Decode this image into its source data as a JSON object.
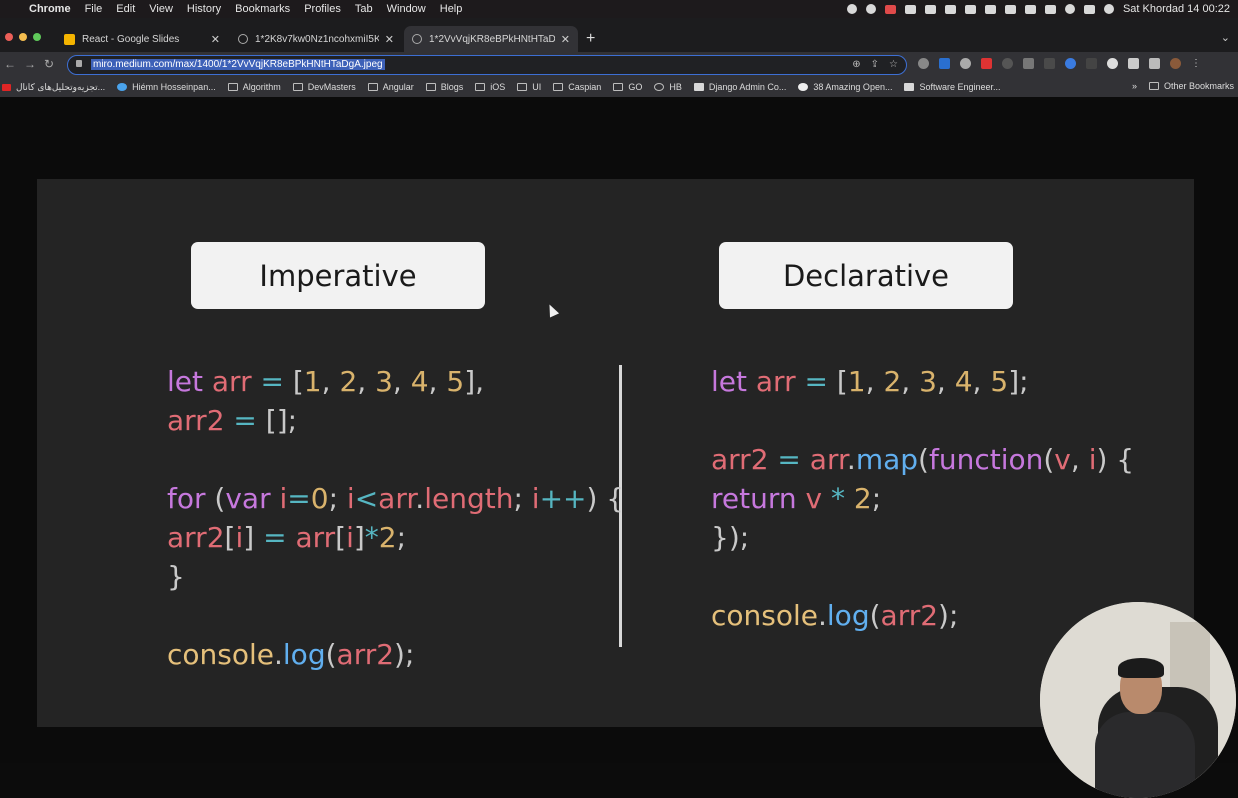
{
  "menubar": {
    "apple_glyph": "",
    "items": [
      "Chrome",
      "File",
      "Edit",
      "View",
      "History",
      "Bookmarks",
      "Profiles",
      "Tab",
      "Window",
      "Help"
    ],
    "clock": "Sat Khordad 14  00:22"
  },
  "tabs": [
    {
      "title": "React - Google Slides",
      "active": false
    },
    {
      "title": "1*2K8v7kw0Nz1ncohxmiI5KA.j",
      "active": false
    },
    {
      "title": "1*2VvVqjKR8eBPkHNtHTaDgA",
      "active": true
    }
  ],
  "toolbar": {
    "url": "miro.medium.com/max/1400/1*2VvVqjKR8eBPkHNtHTaDgA.jpeg"
  },
  "bookmarks": {
    "items": [
      {
        "label": "تجزیه‌وتحلیل‌های کانال...",
        "icon": "youtube-icon"
      },
      {
        "label": "Hiémn Hosseinpan...",
        "icon": "twitter-icon"
      },
      {
        "label": "Algorithm",
        "icon": "folder-icon"
      },
      {
        "label": "DevMasters",
        "icon": "folder-icon"
      },
      {
        "label": "Angular",
        "icon": "folder-icon"
      },
      {
        "label": "Blogs",
        "icon": "folder-icon"
      },
      {
        "label": "iOS",
        "icon": "folder-icon"
      },
      {
        "label": "UI",
        "icon": "folder-icon"
      },
      {
        "label": "Caspian",
        "icon": "folder-icon"
      },
      {
        "label": "GO",
        "icon": "folder-icon"
      },
      {
        "label": "HB",
        "icon": "globe-icon"
      },
      {
        "label": "Django Admin Co...",
        "icon": "page-icon"
      },
      {
        "label": "38 Amazing Open...",
        "icon": "github-icon"
      },
      {
        "label": "Software Engineer...",
        "icon": "page-icon"
      }
    ],
    "overflow": "»",
    "other": "Other Bookmarks"
  },
  "slide": {
    "left_title": "Imperative",
    "right_title": "Declarative",
    "left_code": [
      [
        {
          "t": "let ",
          "c": "kw"
        },
        {
          "t": "arr ",
          "c": "var"
        },
        {
          "t": "= ",
          "c": "op"
        },
        {
          "t": "[",
          "c": "pun"
        },
        {
          "t": "1",
          "c": "num"
        },
        {
          "t": ", ",
          "c": "pun"
        },
        {
          "t": "2",
          "c": "num"
        },
        {
          "t": ", ",
          "c": "pun"
        },
        {
          "t": "3",
          "c": "num"
        },
        {
          "t": ", ",
          "c": "pun"
        },
        {
          "t": "4",
          "c": "num"
        },
        {
          "t": ", ",
          "c": "pun"
        },
        {
          "t": "5",
          "c": "num"
        },
        {
          "t": "],",
          "c": "pun"
        }
      ],
      [
        {
          "t": "arr2 ",
          "c": "var"
        },
        {
          "t": "= ",
          "c": "op"
        },
        {
          "t": "[];",
          "c": "pun"
        }
      ],
      [],
      [
        {
          "t": "for ",
          "c": "kw"
        },
        {
          "t": "(",
          "c": "pun"
        },
        {
          "t": "var ",
          "c": "kw"
        },
        {
          "t": "i",
          "c": "var"
        },
        {
          "t": "=",
          "c": "op"
        },
        {
          "t": "0",
          "c": "num"
        },
        {
          "t": "; ",
          "c": "pun"
        },
        {
          "t": "i",
          "c": "var"
        },
        {
          "t": "<",
          "c": "op"
        },
        {
          "t": "arr",
          "c": "var"
        },
        {
          "t": ".",
          "c": "pun"
        },
        {
          "t": "length",
          "c": "var"
        },
        {
          "t": "; ",
          "c": "pun"
        },
        {
          "t": "i",
          "c": "var"
        },
        {
          "t": "++",
          "c": "op"
        },
        {
          "t": ") {",
          "c": "pun"
        }
      ],
      [
        {
          "t": "arr2",
          "c": "var"
        },
        {
          "t": "[",
          "c": "pun"
        },
        {
          "t": "i",
          "c": "var"
        },
        {
          "t": "] ",
          "c": "pun"
        },
        {
          "t": "= ",
          "c": "op"
        },
        {
          "t": "arr",
          "c": "var"
        },
        {
          "t": "[",
          "c": "pun"
        },
        {
          "t": "i",
          "c": "var"
        },
        {
          "t": "]",
          "c": "pun"
        },
        {
          "t": "*",
          "c": "op"
        },
        {
          "t": "2",
          "c": "num"
        },
        {
          "t": ";",
          "c": "pun"
        }
      ],
      [
        {
          "t": "}",
          "c": "pun"
        }
      ],
      [],
      [
        {
          "t": "console",
          "c": "obj"
        },
        {
          "t": ".",
          "c": "pun"
        },
        {
          "t": "log",
          "c": "fn"
        },
        {
          "t": "(",
          "c": "pun"
        },
        {
          "t": "arr2",
          "c": "var"
        },
        {
          "t": ");",
          "c": "pun"
        }
      ]
    ],
    "right_code": [
      [
        {
          "t": "let ",
          "c": "kw"
        },
        {
          "t": "arr ",
          "c": "var"
        },
        {
          "t": "= ",
          "c": "op"
        },
        {
          "t": "[",
          "c": "pun"
        },
        {
          "t": "1",
          "c": "num"
        },
        {
          "t": ", ",
          "c": "pun"
        },
        {
          "t": "2",
          "c": "num"
        },
        {
          "t": ", ",
          "c": "pun"
        },
        {
          "t": "3",
          "c": "num"
        },
        {
          "t": ", ",
          "c": "pun"
        },
        {
          "t": "4",
          "c": "num"
        },
        {
          "t": ", ",
          "c": "pun"
        },
        {
          "t": "5",
          "c": "num"
        },
        {
          "t": "];",
          "c": "pun"
        }
      ],
      [],
      [
        {
          "t": "arr2 ",
          "c": "var"
        },
        {
          "t": "= ",
          "c": "op"
        },
        {
          "t": "arr",
          "c": "var"
        },
        {
          "t": ".",
          "c": "pun"
        },
        {
          "t": "map",
          "c": "fn"
        },
        {
          "t": "(",
          "c": "pun"
        },
        {
          "t": "function",
          "c": "kw"
        },
        {
          "t": "(",
          "c": "pun"
        },
        {
          "t": "v",
          "c": "var"
        },
        {
          "t": ", ",
          "c": "pun"
        },
        {
          "t": "i",
          "c": "var"
        },
        {
          "t": ") {",
          "c": "pun"
        }
      ],
      [
        {
          "t": "return ",
          "c": "kw"
        },
        {
          "t": "v ",
          "c": "var"
        },
        {
          "t": "* ",
          "c": "op"
        },
        {
          "t": "2",
          "c": "num"
        },
        {
          "t": ";",
          "c": "pun"
        }
      ],
      [
        {
          "t": "});",
          "c": "pun"
        }
      ],
      [],
      [
        {
          "t": "console",
          "c": "obj"
        },
        {
          "t": ".",
          "c": "pun"
        },
        {
          "t": "log",
          "c": "fn"
        },
        {
          "t": "(",
          "c": "pun"
        },
        {
          "t": "arr2",
          "c": "var"
        },
        {
          "t": ");",
          "c": "pun"
        }
      ]
    ]
  },
  "colors": {
    "keyword": "#c678dd",
    "variable": "#e06c75",
    "number": "#d9b36c",
    "operator": "#56b6c2",
    "function": "#61afef",
    "object": "#e5c07b",
    "slide_bg": "#242424",
    "omnibox_focus": "#3d6fd4"
  }
}
